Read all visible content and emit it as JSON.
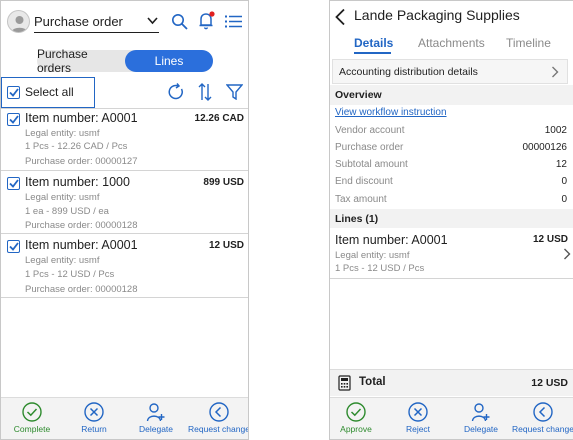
{
  "left": {
    "header": {
      "title": "Purchase order",
      "title_icon": "chevron-down-icon",
      "icons": [
        "search-icon",
        "bell-icon",
        "list-icon"
      ]
    },
    "segments": [
      "Purchase orders",
      "Lines"
    ],
    "toolbar": {
      "select_all_label": "Select all",
      "icons": [
        "refresh-icon",
        "sort-icon",
        "filter-icon"
      ]
    },
    "items": [
      {
        "title": "Item number: A0001",
        "amount": "12.26 CAD",
        "legal": "Legal entity: usmf",
        "qty": "1 Pcs - 12.26 CAD / Pcs",
        "po": "Purchase order: 00000127"
      },
      {
        "title": "Item number: 1000",
        "amount": "899 USD",
        "legal": "Legal entity: usmf",
        "qty": "1 ea - 899 USD / ea",
        "po": "Purchase order: 00000128"
      },
      {
        "title": "Item number: A0001",
        "amount": "12 USD",
        "legal": "Legal entity: usmf",
        "qty": "1 Pcs - 12 USD / Pcs",
        "po": "Purchase order: 00000128"
      }
    ],
    "footer": [
      {
        "label": "Complete",
        "icon": "check-icon",
        "color": "#2e8b2e"
      },
      {
        "label": "Return",
        "icon": "close-icon",
        "color": "#2266c4"
      },
      {
        "label": "Delegate",
        "icon": "person-add-icon",
        "color": "#2266c4"
      },
      {
        "label": "Request change",
        "icon": "chevron-left-icon",
        "color": "#2266c4"
      }
    ]
  },
  "right": {
    "header": {
      "title": "Lande Packaging Supplies",
      "back_icon": "back-arrow-icon"
    },
    "tabs": [
      "Details",
      "Attachments",
      "Timeline"
    ],
    "accounting_label": "Accounting distribution details",
    "overview_heading": "Overview",
    "workflow_link": "View workflow instruction",
    "fields": [
      {
        "label": "Vendor account",
        "value": "1002"
      },
      {
        "label": "Purchase order",
        "value": "00000126"
      },
      {
        "label": "Subtotal amount",
        "value": "12"
      },
      {
        "label": "End discount",
        "value": "0"
      },
      {
        "label": "Tax amount",
        "value": "0"
      }
    ],
    "lines_heading": "Lines (1)",
    "line": {
      "title": "Item number: A0001",
      "amount": "12 USD",
      "legal": "Legal entity: usmf",
      "qty": "1 Pcs - 12 USD / Pcs"
    },
    "total": {
      "label": "Total",
      "value": "12 USD",
      "icon": "calculator-icon"
    },
    "footer": [
      {
        "label": "Approve",
        "icon": "check-icon",
        "color": "#2e8b2e"
      },
      {
        "label": "Reject",
        "icon": "close-icon",
        "color": "#2266c4"
      },
      {
        "label": "Delegate",
        "icon": "person-add-icon",
        "color": "#2266c4"
      },
      {
        "label": "Request change",
        "icon": "chevron-left-icon",
        "color": "#2266c4"
      }
    ]
  },
  "colors": {
    "accent": "#2266c4",
    "segment_active": "#2b6fdc",
    "approve": "#2e8b2e",
    "notification": "#e02020"
  }
}
